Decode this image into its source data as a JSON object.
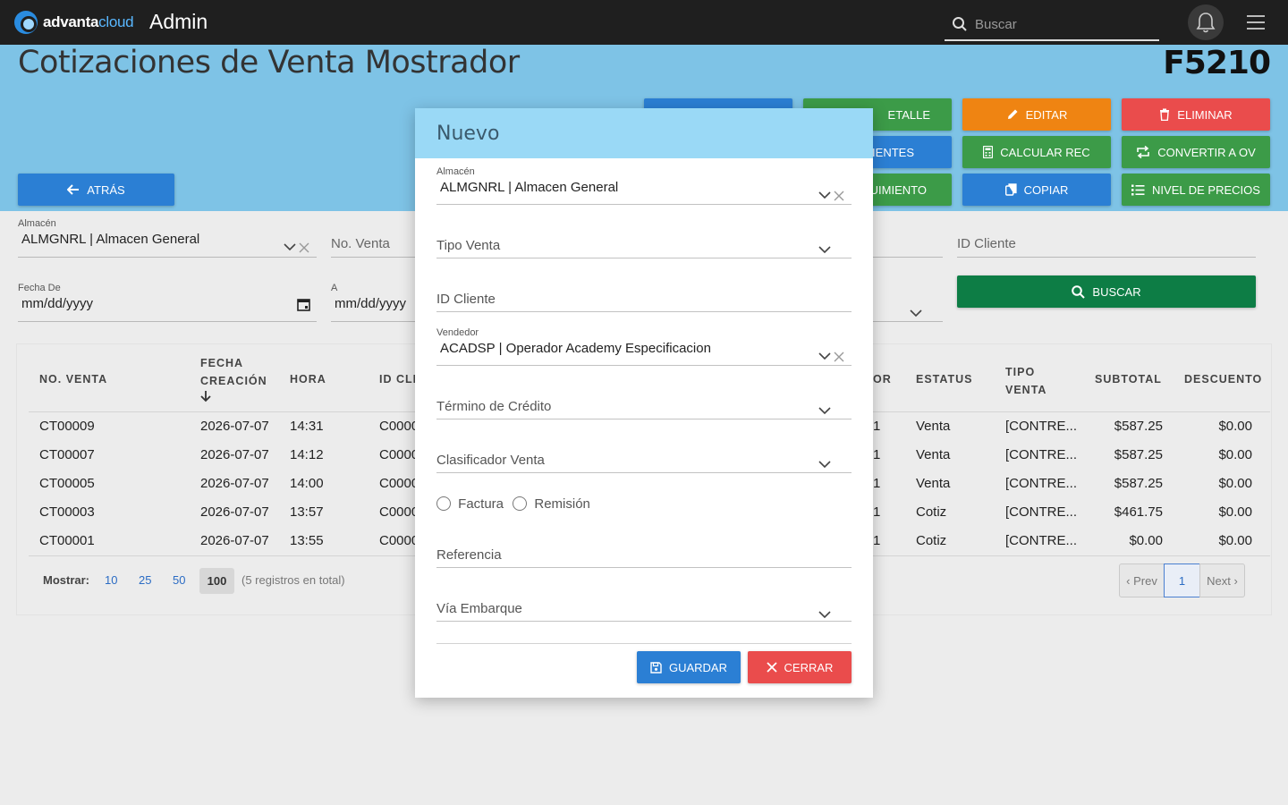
{
  "topbar": {
    "logo_word_a": "advanta",
    "logo_word_b": "cloud",
    "app_title": "Admin",
    "search_placeholder": "Buscar",
    "icons": [
      "search-icon",
      "bell-icon",
      "hamburger-menu-icon"
    ]
  },
  "header": {
    "title": "Cotizaciones de Venta Mostrador",
    "code": "F5210",
    "back_label": "ATRÁS",
    "buttons": {
      "detalle": "ETALLE",
      "editar": "EDITAR",
      "eliminar": "ELIMINAR",
      "clientes": "LIENTES",
      "calcular": "CALCULAR REC",
      "convertir": "CONVERTIR A OV",
      "seguimiento": "UIMIENTO",
      "copiar": "COPIAR",
      "nivel": "NIVEL DE PRECIOS"
    }
  },
  "filters": {
    "almacen_label": "Almacén",
    "almacen_value": "ALMGNRL | Almacen General",
    "no_venta_placeholder": "No. Venta",
    "id_cliente_placeholder": "ID Cliente",
    "fecha_de_label": "Fecha De",
    "fecha_de_value": "mm/dd/yyyy",
    "fecha_a_label": "A",
    "fecha_a_value": "mm/dd/yyyy",
    "buscar_label": "BUSCAR"
  },
  "table": {
    "headers": {
      "no_venta": "NO. VENTA",
      "fecha_1": "FECHA",
      "fecha_2": "CREACIÓN",
      "hora": "HORA",
      "id_cliente": "ID CLI",
      "vendedor": "OR",
      "estatus": "ESTATUS",
      "tipo_1": "TIPO",
      "tipo_2": "VENTA",
      "subtotal": "SUBTOTAL",
      "descuento": "DESCUENTO"
    },
    "rows": [
      {
        "no_venta": "CT00009",
        "fecha": "2026-07-07",
        "hora": "14:31",
        "cliente": "C0000",
        "vendedor": "1",
        "estatus": "Venta",
        "tipo": "[CONTRE...",
        "subtotal": "$587.25",
        "descuento": "$0.00"
      },
      {
        "no_venta": "CT00007",
        "fecha": "2026-07-07",
        "hora": "14:12",
        "cliente": "C0000",
        "vendedor": "1",
        "estatus": "Venta",
        "tipo": "[CONTRE...",
        "subtotal": "$587.25",
        "descuento": "$0.00"
      },
      {
        "no_venta": "CT00005",
        "fecha": "2026-07-07",
        "hora": "14:00",
        "cliente": "C0000",
        "vendedor": "1",
        "estatus": "Venta",
        "tipo": "[CONTRE...",
        "subtotal": "$587.25",
        "descuento": "$0.00"
      },
      {
        "no_venta": "CT00003",
        "fecha": "2026-07-07",
        "hora": "13:57",
        "cliente": "C0000",
        "vendedor": "1",
        "estatus": "Cotiz",
        "tipo": "[CONTRE...",
        "subtotal": "$461.75",
        "descuento": "$0.00"
      },
      {
        "no_venta": "CT00001",
        "fecha": "2026-07-07",
        "hora": "13:55",
        "cliente": "C0000",
        "vendedor": "1",
        "estatus": "Cotiz",
        "tipo": "[CONTRE...",
        "subtotal": "$0.00",
        "descuento": "$0.00"
      }
    ],
    "mostrar_label": "Mostrar:",
    "page_sizes": [
      "10",
      "25",
      "50",
      "100"
    ],
    "total_text": "(5 registros en total)",
    "prev": "‹ Prev",
    "page": "1",
    "next": "Next ›"
  },
  "modal": {
    "title": "Nuevo",
    "almacen_label": "Almacén",
    "almacen_value": "ALMGNRL | Almacen General",
    "tipo_venta": "Tipo Venta",
    "id_cliente": "ID Cliente",
    "vendedor_label": "Vendedor",
    "vendedor_value": "ACADSP | Operador Academy Especificacion",
    "termino": "Término de Crédito",
    "clasificador": "Clasificador Venta",
    "radio_factura": "Factura",
    "radio_remision": "Remisión",
    "referencia": "Referencia",
    "via": "Vía Embarque",
    "guardar": "GUARDAR",
    "cerrar": "CERRAR"
  },
  "colors": {
    "header_band": "#7ec3e6",
    "modal_head": "#9ad9f6",
    "blue": "#2b7fd4",
    "green": "#3c9b48",
    "orange": "#ef8412",
    "red": "#ea4c4c",
    "dark_green": "#0d7d45"
  }
}
